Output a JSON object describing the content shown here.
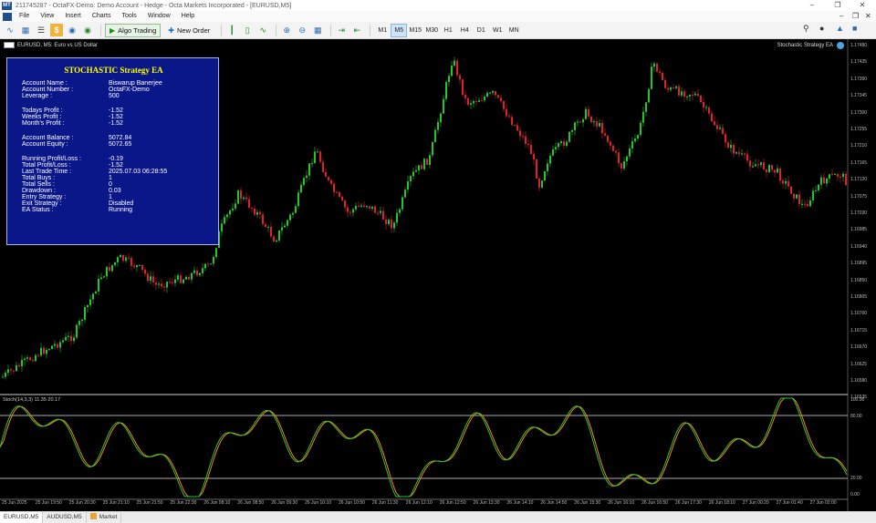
{
  "window": {
    "title": "211745287 - OctaFX-Demo: Demo Account - Hedge - Octa Markets Incorporated - [EURUSD,M5]",
    "logo": "MT"
  },
  "menu": [
    "File",
    "View",
    "Insert",
    "Charts",
    "Tools",
    "Window",
    "Help"
  ],
  "toolbar": {
    "algo_trading": "Algo Trading",
    "new_order": "New Order",
    "timeframes": [
      "M1",
      "M5",
      "M15",
      "M30",
      "H1",
      "H4",
      "D1",
      "W1",
      "MN"
    ],
    "active_timeframe": "M5"
  },
  "chart": {
    "header": "EURUSD, M5:  Euro vs US Dollar",
    "ea_label": "Stochastic Strategy EA",
    "indicator_label": "Stoch(14,3,3) 11.35 20.17",
    "price_labels": [
      "1.17480",
      "1.17435",
      "1.17390",
      "1.17345",
      "1.17300",
      "1.17255",
      "1.17210",
      "1.17165",
      "1.17120",
      "1.17075",
      "1.17030",
      "1.16985",
      "1.16940",
      "1.16895",
      "1.16850",
      "1.16805",
      "1.16760",
      "1.16715",
      "1.16670",
      "1.16625",
      "1.16580",
      "1.16535"
    ],
    "stoch_levels": [
      "100.00",
      "80.00",
      "20.00",
      "0.00"
    ],
    "time_labels": [
      "25 Jun 2025",
      "25 Jun 19:50",
      "25 Jun 20:30",
      "25 Jun 21:10",
      "25 Jun 21:50",
      "25 Jun 22:30",
      "26 Jun 08:10",
      "26 Jun 08:50",
      "26 Jun 09:30",
      "26 Jun 10:10",
      "26 Jun 10:50",
      "26 Jun 11:30",
      "26 Jun 12:10",
      "26 Jun 12:50",
      "26 Jun 13:30",
      "26 Jun 14:10",
      "26 Jun 14:50",
      "26 Jun 15:30",
      "26 Jun 16:10",
      "26 Jun 16:50",
      "26 Jun 17:30",
      "26 Jun 18:10",
      "27 Jun 00:20",
      "27 Jun 01:40",
      "27 Jun 02:00"
    ]
  },
  "panel": {
    "title": "STOCHASTIC Strategy EA",
    "rows": [
      {
        "label": "Account Name :",
        "value": "Biswarup Banerjee"
      },
      {
        "label": "Account Number :",
        "value": "OctaFX-Demo"
      },
      {
        "label": "Leverage :",
        "value": "500"
      },
      {
        "label": "Todays Profit :",
        "value": "-1.52"
      },
      {
        "label": "Weeks Profit :",
        "value": "-1.52"
      },
      {
        "label": "Month's Profit :",
        "value": "-1.52"
      },
      {
        "label": "Account Balance :",
        "value": "5072.84"
      },
      {
        "label": "Account Equity :",
        "value": "5072.65"
      },
      {
        "label": "Running Profit/Loss :",
        "value": "-0.19"
      },
      {
        "label": "Total Profit/Loss :",
        "value": "-1.52"
      },
      {
        "label": "Last Trade Time :",
        "value": "2025.07.03 06:28:55"
      },
      {
        "label": "Total Buys :",
        "value": "1"
      },
      {
        "label": "Total Sells :",
        "value": "0"
      },
      {
        "label": "Drawdown :",
        "value": "0.03"
      },
      {
        "label": "Entry Strategy :",
        "value": "1"
      },
      {
        "label": "Exit Strategy :",
        "value": "Disabled"
      },
      {
        "label": "EA Status :",
        "value": "Running"
      }
    ]
  },
  "tabs": [
    "EURUSD,M5",
    "AUDUSD,M5",
    "Market"
  ],
  "colors": {
    "bull": "#22c72a",
    "bear": "#e0202a",
    "panel_bg": "#0a1788",
    "panel_title": "#ffff00",
    "stoch_main": "#22c72a",
    "stoch_signal": "#ff7f1f"
  }
}
